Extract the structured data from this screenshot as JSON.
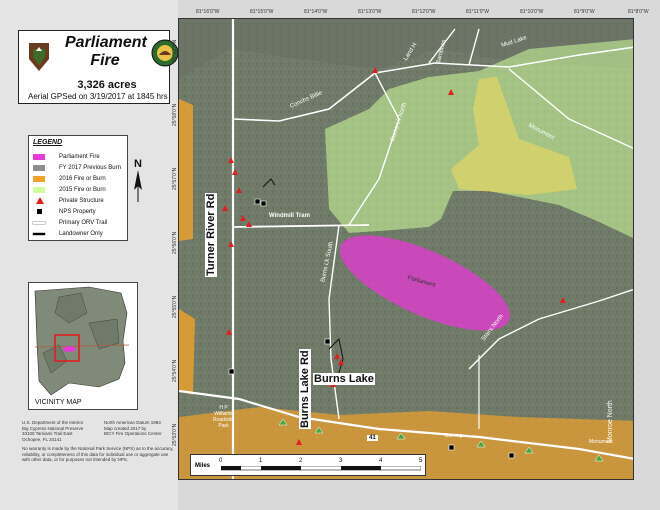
{
  "title": {
    "name": "Parliament Fire",
    "acres": "3,326 acres",
    "gps": "Aerial GPSed on 3/19/2017 at 1845 hrs"
  },
  "legend": {
    "title": "LEGEND",
    "items": [
      {
        "label": "Parliament Fire",
        "color": "#e83ad6",
        "symbol": "fill"
      },
      {
        "label": "FY 2017 Previous Burn",
        "color": "#8e8e8e",
        "symbol": "fill"
      },
      {
        "label": "2016 Fire or Burn",
        "color": "#f0a22b",
        "symbol": "fill"
      },
      {
        "label": "2015 Fire or Burn",
        "color": "#cfff9a",
        "symbol": "fill"
      },
      {
        "label": "Private Structure",
        "color": "#e01f1f",
        "symbol": "triangle"
      },
      {
        "label": "NPS Property",
        "color": "#000000",
        "symbol": "square"
      },
      {
        "label": "Primary ORV Trail",
        "color": "#ffffff",
        "symbol": "line"
      },
      {
        "label": "Landowner Only",
        "color": "#000000",
        "symbol": "line"
      }
    ]
  },
  "north_label": "N",
  "vicinity_label": "VICINITY MAP",
  "footer_left": "U.S. Department of the Interior\nBig Cypress National Preserve\n33100 Tamiami Trail East\nOchopee, FL 34141",
  "footer_right": "North American Datum 1983\nMap created 2017 by\nBICY Fire Operations Center",
  "disclaimer": "No warranty is made by the National Park Service (NPS) as to the accuracy, reliability, or completeness of this data for individual use or aggregate use with other data, or for purposes not intended by NPS.",
  "coords_top": [
    "81°16'0\"W",
    "81°15'0\"W",
    "81°14'0\"W",
    "81°13'0\"W",
    "81°12'0\"W",
    "81°11'0\"W",
    "81°10'0\"W",
    "81°9'0\"W",
    "81°8'0\"W"
  ],
  "coords_left": [
    "25°59'0\"N",
    "25°58'0\"N",
    "25°57'0\"N",
    "25°56'0\"N",
    "25°55'0\"N",
    "25°54'0\"N",
    "25°53'0\"N"
  ],
  "map_labels": {
    "conchs_billie": "Conchs Billie",
    "burns_lk_north": "Burns Lk North",
    "land_h": "Land H",
    "bamboos": "Bamboos",
    "mud_lake": "Mud Lake",
    "monument": "Monument",
    "turner_river_rd": "Turner River Rd",
    "windmill_tram": "Windmill Tram",
    "burns_lk_south": "Burns Lk South",
    "parliament": "Parliament",
    "stairs_north": "Stairs North",
    "burns_lake": "Burns Lake",
    "burns_lake_rd": "Burns Lake Rd",
    "hp_williams": "H P\nWilliams\nRoadside\nPark",
    "burning": "Burning",
    "monument2": "Monument",
    "monroe_north": "Monroe North",
    "route_41": "41"
  },
  "scale": {
    "label": "Miles",
    "ticks": [
      "0",
      "1",
      "2",
      "3",
      "4",
      "5"
    ]
  }
}
